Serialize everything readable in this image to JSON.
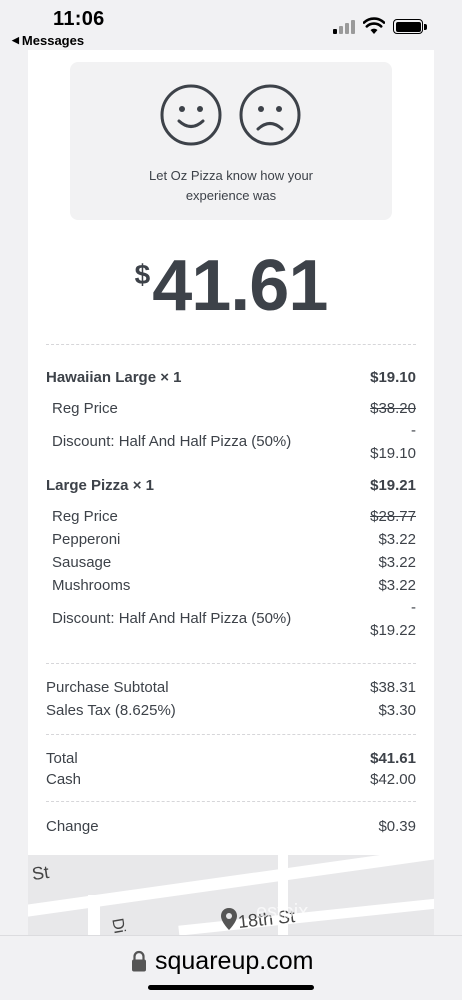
{
  "status_bar": {
    "time": "11:06",
    "back_label": "Messages",
    "back_arrow": "◀"
  },
  "feedback": {
    "message": "Let Oz Pizza know how your experience was"
  },
  "total_display": {
    "currency": "$",
    "amount": "41.61"
  },
  "items": [
    {
      "name": "Hawaiian Large × 1",
      "price": "$19.10",
      "lines": [
        {
          "label": "Reg Price",
          "value": "$38.20",
          "strike": true
        },
        {
          "label": "Discount: Half And Half Pizza (50%)",
          "value_top": "-",
          "value": "$19.10"
        }
      ]
    },
    {
      "name": "Large Pizza × 1",
      "price": "$19.21",
      "lines": [
        {
          "label": "Reg Price",
          "value": "$28.77",
          "strike": true
        },
        {
          "label": "Pepperoni",
          "value": "$3.22"
        },
        {
          "label": "Sausage",
          "value": "$3.22"
        },
        {
          "label": "Mushrooms",
          "value": "$3.22"
        },
        {
          "label": "Discount: Half And Half Pizza (50%)",
          "value_top": "-",
          "value": "$19.22"
        }
      ]
    }
  ],
  "summary": {
    "subtotal_label": "Purchase Subtotal",
    "subtotal_value": "$38.31",
    "tax_label": "Sales Tax (8.625%)",
    "tax_value": "$3.30"
  },
  "payment": {
    "total_label": "Total",
    "total_value": "$41.61",
    "cash_label": "Cash",
    "cash_value": "$42.00",
    "change_label": "Change",
    "change_value": "$0.39"
  },
  "map": {
    "street_1": "St",
    "street_2": "18th St",
    "street_3": "Di",
    "watermark": "estpix"
  },
  "address_bar": {
    "url": "squareup.com"
  },
  "colors": {
    "text": "#3d4249",
    "card": "#ffffff",
    "background": "#f1f1f3"
  }
}
